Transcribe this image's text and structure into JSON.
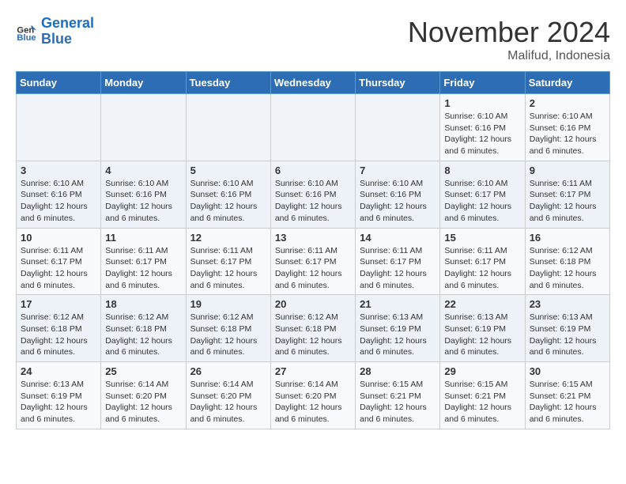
{
  "logo": {
    "line1": "General",
    "line2": "Blue"
  },
  "calendar": {
    "title": "November 2024",
    "subtitle": "Malifud, Indonesia"
  },
  "weekdays": [
    "Sunday",
    "Monday",
    "Tuesday",
    "Wednesday",
    "Thursday",
    "Friday",
    "Saturday"
  ],
  "weeks": [
    [
      {
        "day": "",
        "info": ""
      },
      {
        "day": "",
        "info": ""
      },
      {
        "day": "",
        "info": ""
      },
      {
        "day": "",
        "info": ""
      },
      {
        "day": "",
        "info": ""
      },
      {
        "day": "1",
        "info": "Sunrise: 6:10 AM\nSunset: 6:16 PM\nDaylight: 12 hours and 6 minutes."
      },
      {
        "day": "2",
        "info": "Sunrise: 6:10 AM\nSunset: 6:16 PM\nDaylight: 12 hours and 6 minutes."
      }
    ],
    [
      {
        "day": "3",
        "info": "Sunrise: 6:10 AM\nSunset: 6:16 PM\nDaylight: 12 hours and 6 minutes."
      },
      {
        "day": "4",
        "info": "Sunrise: 6:10 AM\nSunset: 6:16 PM\nDaylight: 12 hours and 6 minutes."
      },
      {
        "day": "5",
        "info": "Sunrise: 6:10 AM\nSunset: 6:16 PM\nDaylight: 12 hours and 6 minutes."
      },
      {
        "day": "6",
        "info": "Sunrise: 6:10 AM\nSunset: 6:16 PM\nDaylight: 12 hours and 6 minutes."
      },
      {
        "day": "7",
        "info": "Sunrise: 6:10 AM\nSunset: 6:16 PM\nDaylight: 12 hours and 6 minutes."
      },
      {
        "day": "8",
        "info": "Sunrise: 6:10 AM\nSunset: 6:17 PM\nDaylight: 12 hours and 6 minutes."
      },
      {
        "day": "9",
        "info": "Sunrise: 6:11 AM\nSunset: 6:17 PM\nDaylight: 12 hours and 6 minutes."
      }
    ],
    [
      {
        "day": "10",
        "info": "Sunrise: 6:11 AM\nSunset: 6:17 PM\nDaylight: 12 hours and 6 minutes."
      },
      {
        "day": "11",
        "info": "Sunrise: 6:11 AM\nSunset: 6:17 PM\nDaylight: 12 hours and 6 minutes."
      },
      {
        "day": "12",
        "info": "Sunrise: 6:11 AM\nSunset: 6:17 PM\nDaylight: 12 hours and 6 minutes."
      },
      {
        "day": "13",
        "info": "Sunrise: 6:11 AM\nSunset: 6:17 PM\nDaylight: 12 hours and 6 minutes."
      },
      {
        "day": "14",
        "info": "Sunrise: 6:11 AM\nSunset: 6:17 PM\nDaylight: 12 hours and 6 minutes."
      },
      {
        "day": "15",
        "info": "Sunrise: 6:11 AM\nSunset: 6:17 PM\nDaylight: 12 hours and 6 minutes."
      },
      {
        "day": "16",
        "info": "Sunrise: 6:12 AM\nSunset: 6:18 PM\nDaylight: 12 hours and 6 minutes."
      }
    ],
    [
      {
        "day": "17",
        "info": "Sunrise: 6:12 AM\nSunset: 6:18 PM\nDaylight: 12 hours and 6 minutes."
      },
      {
        "day": "18",
        "info": "Sunrise: 6:12 AM\nSunset: 6:18 PM\nDaylight: 12 hours and 6 minutes."
      },
      {
        "day": "19",
        "info": "Sunrise: 6:12 AM\nSunset: 6:18 PM\nDaylight: 12 hours and 6 minutes."
      },
      {
        "day": "20",
        "info": "Sunrise: 6:12 AM\nSunset: 6:18 PM\nDaylight: 12 hours and 6 minutes."
      },
      {
        "day": "21",
        "info": "Sunrise: 6:13 AM\nSunset: 6:19 PM\nDaylight: 12 hours and 6 minutes."
      },
      {
        "day": "22",
        "info": "Sunrise: 6:13 AM\nSunset: 6:19 PM\nDaylight: 12 hours and 6 minutes."
      },
      {
        "day": "23",
        "info": "Sunrise: 6:13 AM\nSunset: 6:19 PM\nDaylight: 12 hours and 6 minutes."
      }
    ],
    [
      {
        "day": "24",
        "info": "Sunrise: 6:13 AM\nSunset: 6:19 PM\nDaylight: 12 hours and 6 minutes."
      },
      {
        "day": "25",
        "info": "Sunrise: 6:14 AM\nSunset: 6:20 PM\nDaylight: 12 hours and 6 minutes."
      },
      {
        "day": "26",
        "info": "Sunrise: 6:14 AM\nSunset: 6:20 PM\nDaylight: 12 hours and 6 minutes."
      },
      {
        "day": "27",
        "info": "Sunrise: 6:14 AM\nSunset: 6:20 PM\nDaylight: 12 hours and 6 minutes."
      },
      {
        "day": "28",
        "info": "Sunrise: 6:15 AM\nSunset: 6:21 PM\nDaylight: 12 hours and 6 minutes."
      },
      {
        "day": "29",
        "info": "Sunrise: 6:15 AM\nSunset: 6:21 PM\nDaylight: 12 hours and 6 minutes."
      },
      {
        "day": "30",
        "info": "Sunrise: 6:15 AM\nSunset: 6:21 PM\nDaylight: 12 hours and 6 minutes."
      }
    ]
  ]
}
